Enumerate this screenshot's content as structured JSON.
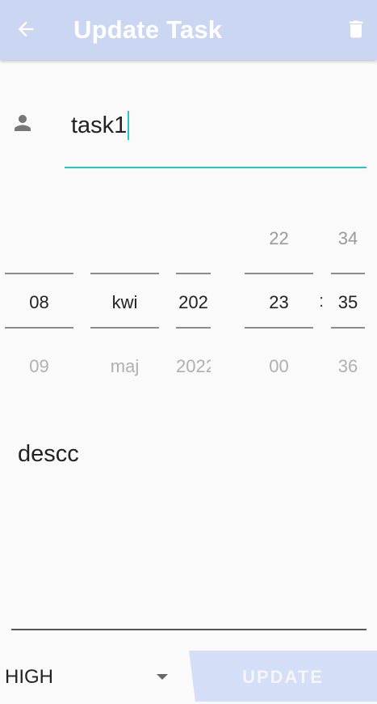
{
  "appbar": {
    "title": "Update Task",
    "back_icon": "arrow-back-icon",
    "delete_icon": "trash-icon",
    "color": "#cbd7f2"
  },
  "task_name": {
    "value": "task1",
    "icon": "person-icon",
    "accent": "#26c6c6"
  },
  "date_picker": {
    "day": {
      "prev": "",
      "current": "08",
      "next": "09"
    },
    "month": {
      "prev": "",
      "current": "kwi",
      "next": "maj"
    },
    "year": {
      "prev": "",
      "current": "202",
      "next": "2022"
    }
  },
  "time_picker": {
    "hour": {
      "prev": "22",
      "current": "23",
      "next": "00"
    },
    "separator": ":",
    "minute": {
      "prev": "34",
      "current": "35",
      "next": "36"
    }
  },
  "description": {
    "value": "descc"
  },
  "priority": {
    "selected": "HIGH"
  },
  "update_button": {
    "label": "UPDATE",
    "color": "#d4def7"
  }
}
